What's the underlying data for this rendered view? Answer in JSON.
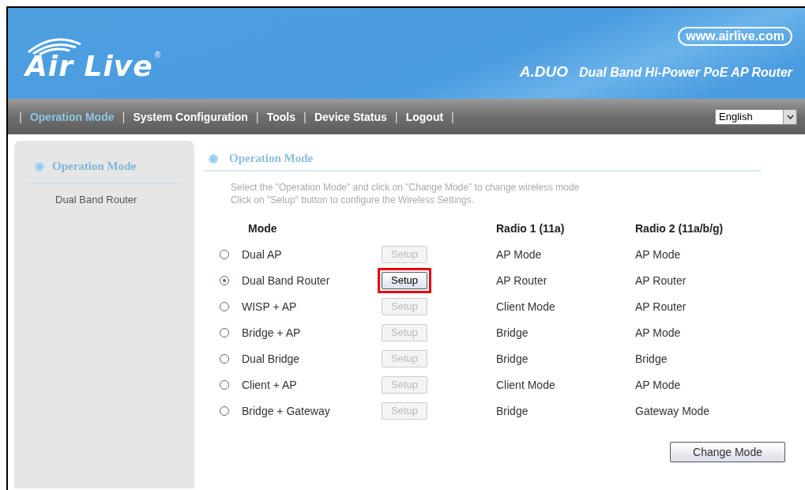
{
  "header": {
    "logo": "Air Live",
    "logo_mark": "®",
    "url": "www.airlive.com",
    "model": "A.DUO",
    "tagline": "Dual Band Hi-Power PoE AP Router"
  },
  "nav": {
    "items": [
      {
        "label": "Operation Mode",
        "selected": true
      },
      {
        "label": "System Configuration",
        "selected": false
      },
      {
        "label": "Tools",
        "selected": false
      },
      {
        "label": "Device Status",
        "selected": false
      },
      {
        "label": "Logout",
        "selected": false
      }
    ],
    "separator": "|",
    "language": "English"
  },
  "sidebar": {
    "title": "Operation Mode",
    "items": [
      {
        "label": "Dual Band Router",
        "selected": false
      }
    ]
  },
  "main": {
    "title": "Operation Mode",
    "description": [
      "Select the \"Operation Mode\" and click on \"Change Mode\" to change wireless mode",
      "Click on \"Setup\" button to configure the Wireless Settings."
    ],
    "table": {
      "columns": [
        "Mode",
        "Radio 1 (11a)",
        "Radio 2 (11a/b/g)"
      ],
      "rows": [
        {
          "mode": "Dual AP",
          "selected": false,
          "setup": "Setup",
          "setup_disabled": true,
          "highlighted": false,
          "radio1": "AP Mode",
          "radio2": "AP Mode"
        },
        {
          "mode": "Dual Band Router",
          "selected": true,
          "setup": "Setup",
          "setup_disabled": false,
          "highlighted": true,
          "radio1": "AP Router",
          "radio2": "AP Router"
        },
        {
          "mode": "WISP + AP",
          "selected": false,
          "setup": "Setup",
          "setup_disabled": true,
          "highlighted": false,
          "radio1": "Client Mode",
          "radio2": "AP Router"
        },
        {
          "mode": "Bridge + AP",
          "selected": false,
          "setup": "Setup",
          "setup_disabled": true,
          "highlighted": false,
          "radio1": "Bridge",
          "radio2": "AP Mode"
        },
        {
          "mode": "Dual Bridge",
          "selected": false,
          "setup": "Setup",
          "setup_disabled": true,
          "highlighted": false,
          "radio1": "Bridge",
          "radio2": "Bridge"
        },
        {
          "mode": "Client + AP",
          "selected": false,
          "setup": "Setup",
          "setup_disabled": true,
          "highlighted": false,
          "radio1": "Client Mode",
          "radio2": "AP Mode"
        },
        {
          "mode": "Bridge + Gateway",
          "selected": false,
          "setup": "Setup",
          "setup_disabled": true,
          "highlighted": false,
          "radio1": "Bridge",
          "radio2": "Gateway Mode"
        }
      ]
    },
    "button": "Change Mode"
  }
}
